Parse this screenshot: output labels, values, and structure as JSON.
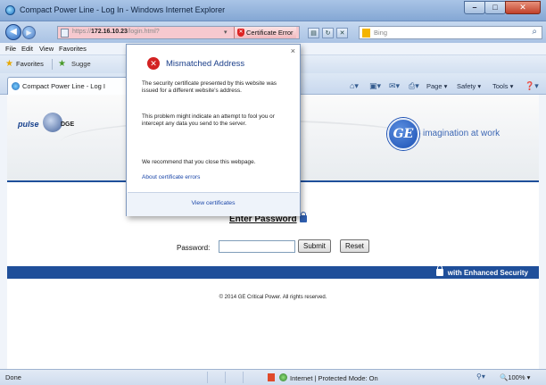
{
  "window": {
    "title": "Compact Power Line - Log In - Windows Internet Explorer",
    "buttons": {
      "minimize": "–",
      "maximize": "□",
      "close": "✕"
    }
  },
  "address_bar": {
    "url_prefix": "https://",
    "url_host": "172.16.10.23",
    "url_path": "/login.html?",
    "cert_error_label": "Certificate Error",
    "search_placeholder": "Bing"
  },
  "menu": [
    "File",
    "Edit",
    "View",
    "Favorites"
  ],
  "favorites_bar": {
    "label": "Favorites",
    "suggested": "Sugge"
  },
  "tab": {
    "label": "Compact Power Line - Log I"
  },
  "command_bar": {
    "page": "Page",
    "safety": "Safety",
    "tools": "Tools"
  },
  "popup": {
    "title": "Mismatched Address",
    "p1": "The security certificate presented by this website was issued for a different website's address.",
    "p2": "This problem might indicate an attempt to fool you or intercept any data you send to the server.",
    "p3": "We recommend that you close this webpage.",
    "about_link": "About certificate errors",
    "view_link": "View certificates",
    "close": "×"
  },
  "page": {
    "brand_left_pulse": "pulse",
    "brand_left_edge": "DGE",
    "ge_mark": "GE",
    "ge_tagline": "imagination at work",
    "heading": "Enter Password",
    "password_label": "Password:",
    "password_value": "",
    "submit_label": "Submit",
    "reset_label": "Reset",
    "security_text": "with Enhanced Security",
    "copyright": "© 2014 GE Critical Power. All rights reserved."
  },
  "status_bar": {
    "status": "Done",
    "zone": "Internet | Protected Mode: On",
    "zoom": "100%"
  },
  "colors": {
    "accent_blue": "#1f4f9a",
    "ge_blue": "#3c67b4",
    "cert_error_bg": "#f6c9cf"
  }
}
